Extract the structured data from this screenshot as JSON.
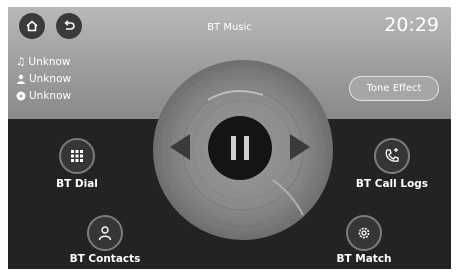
{
  "header": {
    "title": "BT Music",
    "time": "20:29",
    "home_icon": "home-icon",
    "back_icon": "back-icon"
  },
  "track": {
    "song": "Unknow",
    "artist": "Unknow",
    "album": "Unknow"
  },
  "tone_effect_label": "Tone Effect",
  "functions": {
    "dial": "BT Dial",
    "call_logs": "BT Call Logs",
    "contacts": "BT Contacts",
    "match": "BT Match"
  },
  "colors": {
    "top_bar": "#a8a8a8",
    "background": "#232323",
    "button_bg": "#363636",
    "text": "#ffffff"
  }
}
